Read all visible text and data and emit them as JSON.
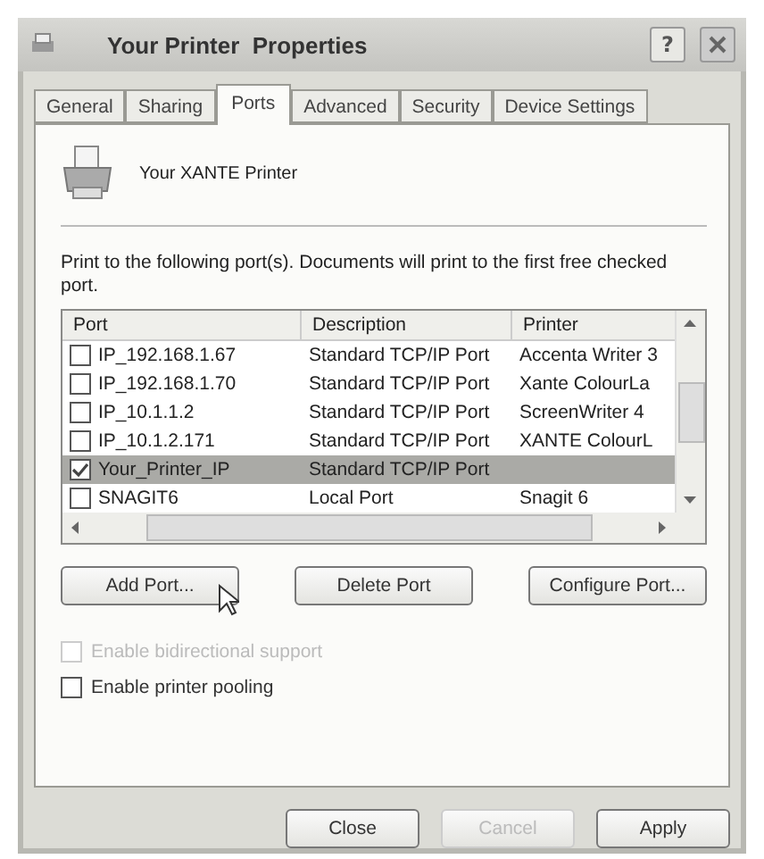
{
  "window": {
    "title": "Your Printer  Properties",
    "help_button": "?"
  },
  "tabs": [
    {
      "label": "General",
      "selected": false
    },
    {
      "label": "Sharing",
      "selected": false
    },
    {
      "label": "Ports",
      "selected": true
    },
    {
      "label": "Advanced",
      "selected": false
    },
    {
      "label": "Security",
      "selected": false
    },
    {
      "label": "Device Settings",
      "selected": false
    }
  ],
  "printer_name": "Your XANTE Printer",
  "instructions": "Print to the following port(s). Documents will print to the first free checked port.",
  "ports_table": {
    "columns": [
      "Port",
      "Description",
      "Printer"
    ],
    "rows": [
      {
        "port": "IP_192.168.1.67",
        "description": "Standard TCP/IP Port",
        "printer": "Accenta Writer 3",
        "checked": false,
        "selected": false
      },
      {
        "port": "IP_192.168.1.70",
        "description": "Standard TCP/IP Port",
        "printer": "Xante ColourLa",
        "checked": false,
        "selected": false
      },
      {
        "port": "IP_10.1.1.2",
        "description": "Standard TCP/IP Port",
        "printer": "ScreenWriter 4",
        "checked": false,
        "selected": false
      },
      {
        "port": "IP_10.1.2.171",
        "description": "Standard TCP/IP Port",
        "printer": "XANTE ColourL",
        "checked": false,
        "selected": false
      },
      {
        "port": "Your_Printer_IP",
        "description": "Standard TCP/IP Port",
        "checked": true,
        "selected": true
      },
      {
        "port": "SNAGIT6",
        "description": "Local Port",
        "printer": "Snagit 6",
        "checked": false,
        "selected": false
      }
    ]
  },
  "port_buttons": [
    {
      "label": "Add Port...",
      "disabled": false
    },
    {
      "label": "Delete Port",
      "disabled": false
    },
    {
      "label": "Configure Port...",
      "disabled": false
    }
  ],
  "options": [
    {
      "label": "Enable bidirectional support",
      "checked": false,
      "disabled": true
    },
    {
      "label": "Enable printer pooling",
      "checked": false,
      "disabled": false
    }
  ],
  "dialog_buttons": [
    {
      "label": "Close",
      "disabled": false
    },
    {
      "label": "Cancel",
      "disabled": true
    },
    {
      "label": "Apply",
      "disabled": false
    }
  ]
}
